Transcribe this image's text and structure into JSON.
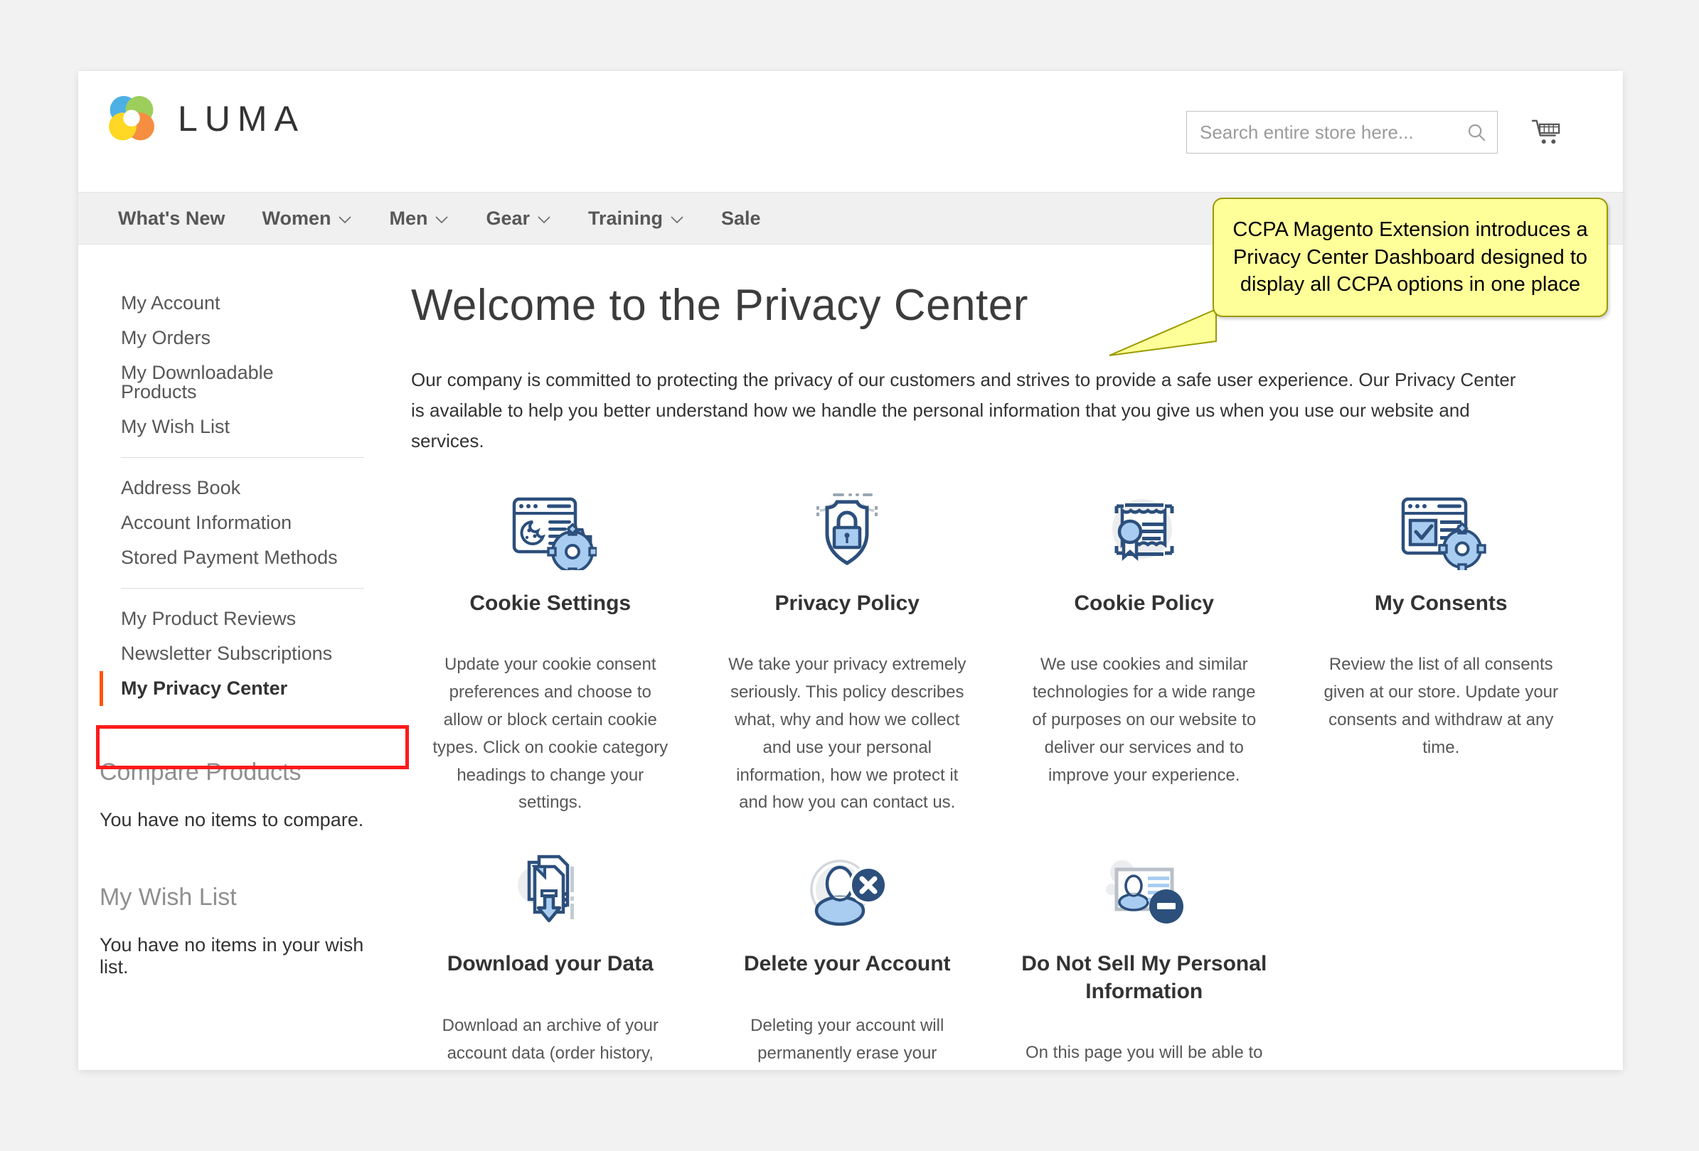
{
  "brand": {
    "name": "LUMA",
    "logo_icon": "luma-flower-logo"
  },
  "header": {
    "search": {
      "placeholder": "Search entire store here...",
      "value": "",
      "search_icon": "search-icon"
    },
    "cart_icon": "shopping-cart-icon"
  },
  "nav": {
    "items": [
      {
        "label": "What's New",
        "has_dropdown": false
      },
      {
        "label": "Women",
        "has_dropdown": true
      },
      {
        "label": "Men",
        "has_dropdown": true
      },
      {
        "label": "Gear",
        "has_dropdown": true
      },
      {
        "label": "Training",
        "has_dropdown": true
      },
      {
        "label": "Sale",
        "has_dropdown": false
      }
    ],
    "chevron": "⌄"
  },
  "sidebar": {
    "group1": [
      {
        "label": "My Account"
      },
      {
        "label": "My Orders"
      },
      {
        "label": "My Downloadable Products"
      },
      {
        "label": "My Wish List"
      }
    ],
    "group2": [
      {
        "label": "Address Book"
      },
      {
        "label": "Account Information"
      },
      {
        "label": "Stored Payment Methods"
      }
    ],
    "group3": [
      {
        "label": "My Product Reviews",
        "current": false
      },
      {
        "label": "Newsletter Subscriptions",
        "current": false
      },
      {
        "label": "My Privacy Center",
        "current": true
      }
    ],
    "compare": {
      "title": "Compare Products",
      "empty_text": "You have no items to compare."
    },
    "wishlist": {
      "title": "My Wish List",
      "empty_text": "You have no items in your wish list."
    }
  },
  "main": {
    "title": "Welcome to the Privacy Center",
    "intro": "Our company is committed to protecting the privacy of our customers and strives to provide a safe user experience. Our Privacy Center is available to help you better understand how we handle the personal information that you give us when you use our website and services.",
    "cards": [
      {
        "icon": "cookie-settings-icon",
        "title": "Cookie Settings",
        "desc": "Update your cookie consent preferences and choose to allow or block certain cookie types. Click on cookie category headings to change your settings."
      },
      {
        "icon": "privacy-policy-shield-icon",
        "title": "Privacy Policy",
        "desc": "We take your privacy extremely seriously. This policy describes what, why and how we collect and use your personal information, how we protect it and how you can contact us."
      },
      {
        "icon": "cookie-policy-certificate-icon",
        "title": "Cookie Policy",
        "desc": "We use cookies and similar technologies for a wide range of purposes on our website to deliver our services and to improve your experience."
      },
      {
        "icon": "my-consents-icon",
        "title": "My Consents",
        "desc": "Review the list of all consents given at our store. Update your consents and withdraw at any time."
      },
      {
        "icon": "download-data-icon",
        "title": "Download your Data",
        "desc": "Download an archive of your account data (order history, addresses, reviews and more)"
      },
      {
        "icon": "delete-account-icon",
        "title": "Delete your Account",
        "desc": "Deleting your account will permanently erase your customer data and access to all personal information from our site."
      },
      {
        "icon": "do-not-sell-icon",
        "title": "Do Not Sell My Personal Information",
        "desc": "On this page you will be able to opt-out of the sale of personal information collected by our store"
      }
    ]
  },
  "annotations": {
    "callout_text": "CCPA Magento Extension introduces a Privacy Center Dashboard designed to display all CCPA options in one place",
    "callout_fill": "#ffff99",
    "callout_border": "#9a9a00",
    "highlight_color": "#ff1a1a"
  },
  "colors": {
    "accent_orange": "#ff5501",
    "icon_dark": "#2c4f7c",
    "icon_light": "#a8cdf0",
    "text_dark": "#333333",
    "text_muted": "#575757"
  }
}
